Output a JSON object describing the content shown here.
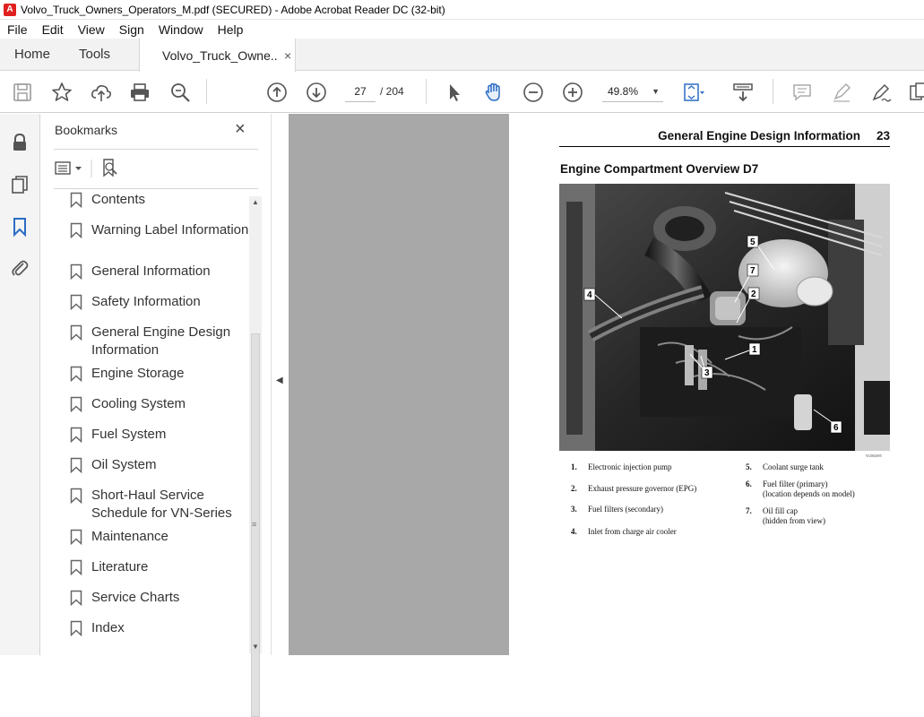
{
  "window": {
    "title": "Volvo_Truck_Owners_Operators_M.pdf (SECURED) - Adobe Acrobat Reader DC (32-bit)"
  },
  "menu": [
    "File",
    "Edit",
    "View",
    "Sign",
    "Window",
    "Help"
  ],
  "tabs": {
    "home": "Home",
    "tools": "Tools",
    "document": "Volvo_Truck_Owne...",
    "close": "×"
  },
  "toolbar": {
    "current_page": "27",
    "total_pages": "/  204",
    "zoom": "49.8%"
  },
  "bookmarks": {
    "title": "Bookmarks",
    "close": "×",
    "items": [
      {
        "label": "Contents"
      },
      {
        "label": "Warning Label Information"
      },
      {
        "label": "General Information"
      },
      {
        "label": "Safety Information"
      },
      {
        "label": "General Engine Design Information"
      },
      {
        "label": "Engine Storage"
      },
      {
        "label": "Cooling System"
      },
      {
        "label": "Fuel System"
      },
      {
        "label": "Oil System"
      },
      {
        "label": "Short-Haul Service Schedule for VN-Series"
      },
      {
        "label": "Maintenance"
      },
      {
        "label": "Literature"
      },
      {
        "label": "Service Charts"
      },
      {
        "label": "Index"
      }
    ]
  },
  "document": {
    "section_header": "General Engine Design Information",
    "page_number": "23",
    "heading": "Engine Compartment Overview D7",
    "photo_code": "W2002695",
    "callouts": [
      "1",
      "2",
      "3",
      "4",
      "5",
      "6",
      "7"
    ],
    "legend": [
      {
        "num": "1.",
        "text": "Electronic injection pump"
      },
      {
        "num": "2.",
        "text": "Exhaust pressure governor (EPG)"
      },
      {
        "num": "3.",
        "text": "Fuel filters (secondary)"
      },
      {
        "num": "4.",
        "text": "Inlet from charge air cooler"
      },
      {
        "num": "5.",
        "text": "Coolant surge tank"
      },
      {
        "num": "6.",
        "text": "Fuel filter (primary)",
        "text2": "(location depends on model)"
      },
      {
        "num": "7.",
        "text": "Oil fill cap",
        "text2": "(hidden from view)"
      }
    ]
  },
  "icons": {
    "app": "acrobat-icon",
    "save": "save-icon",
    "star": "bookmark-star-icon",
    "upload": "upload-icon",
    "print": "print-icon",
    "search": "search-zoom-icon",
    "lock": "lock-icon",
    "copy": "copy-icon",
    "bookmark": "bookmark-icon",
    "attachment": "paperclip-icon"
  }
}
